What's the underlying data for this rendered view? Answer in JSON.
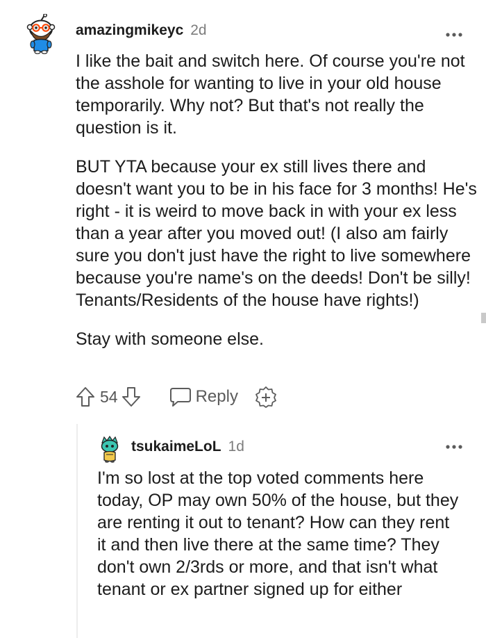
{
  "comments": [
    {
      "username": "amazingmikeyc",
      "age": "2d",
      "avatar_icon": "snoo-avatar-bearded-icon",
      "paragraphs": [
        "I like the bait and switch here. Of course you're not the asshole for wanting to live in your old house temporarily. Why not? But that's not really the question is it.",
        "BUT YTA because your ex still lives there and doesn't want you to be in his face for 3 months! He's right - it is weird to move back in with your ex less than a year after you moved out! (I also am fairly sure you don't just have the right to live somewhere because you're name's on the deeds! Don't be silly! Tenants/Residents of the house have rights!)",
        "Stay with someone else."
      ],
      "score": "54",
      "reply_label": "Reply"
    },
    {
      "username": "tsukaimeLoL",
      "age": "1d",
      "avatar_icon": "snoo-avatar-teal-icon",
      "paragraphs": [
        "I'm so lost at the top voted comments here today, OP may own 50% of the house, but they are renting it out to tenant? How can they rent it and then live there at the same time? They don't own 2/3rds or more, and that isn't what tenant or ex partner signed up for either"
      ]
    }
  ],
  "colors": {
    "text": "#1c1c1c",
    "meta": "#7c7c7c",
    "icon": "#5b5b5b",
    "thread_line": "#ededed"
  }
}
